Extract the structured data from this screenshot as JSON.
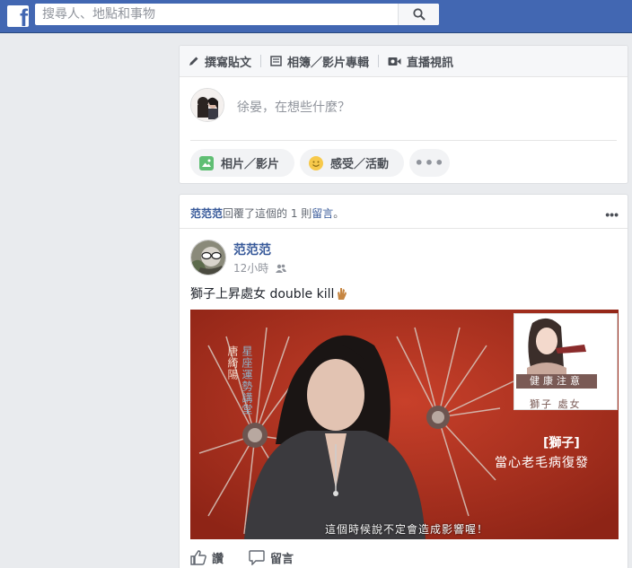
{
  "search": {
    "placeholder": "搜尋人、地點和事物"
  },
  "composer": {
    "tabs": [
      {
        "label": "撰寫貼文",
        "icon": "pencil-icon"
      },
      {
        "label": "相簿／影片專輯",
        "icon": "album-icon"
      },
      {
        "label": "直播視訊",
        "icon": "video-camera-icon"
      }
    ],
    "placeholder": "徐晏，在想些什麼？",
    "photo_label": "相片／影片",
    "feeling_label": "感受／活動",
    "more_label": "•••"
  },
  "post": {
    "story_actor": "范范范",
    "story_text": "回覆了這個的 1 則",
    "story_link": "留言",
    "story_end": "。",
    "more": "•••",
    "author": "范范范",
    "time": "12小時",
    "text": "獅子上昇處女 double kill",
    "media": {
      "vertical_name": "唐綺陽",
      "vertical_show": "星座運勢講堂",
      "badge": "健康注意",
      "signs": "獅子 處女",
      "lion": "[獅子]",
      "warning": "當心老毛病復發",
      "subtitle": "這個時候說不定會造成影響喔！"
    },
    "actions": {
      "like": "讚",
      "comment": "留言"
    }
  }
}
